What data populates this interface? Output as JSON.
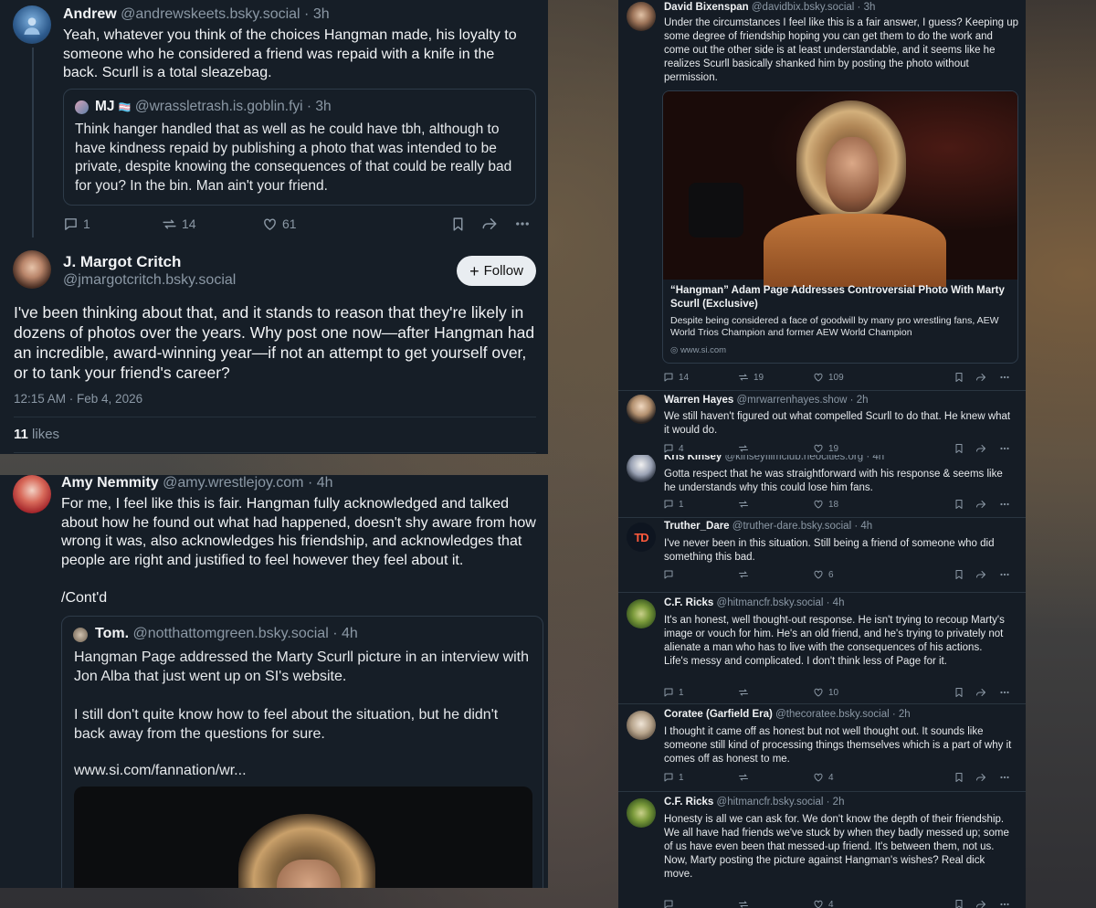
{
  "left_top": {
    "andrew": {
      "name": "Andrew",
      "handle": "@andrewskeets.bsky.social",
      "time": "3h",
      "text": "Yeah, whatever you think of the choices Hangman made, his loyalty to someone who he considered a friend was repaid with a knife in the back. Scurll is a total sleazebag.",
      "quote": {
        "name": "MJ",
        "flag": "🏳️‍⚧️",
        "handle": "@wrassletrash.is.goblin.fyi",
        "time": "3h",
        "text": "Think hanger handled that as well as he could have tbh, although to have kindness repaid by publishing a photo that was intended to be private, despite knowing the consequences of that could be really bad for you? In the bin. Man ain't your friend."
      },
      "replies": "1",
      "reposts": "14",
      "likes": "61"
    },
    "margot": {
      "name": "J. Margot Critch",
      "handle": "@jmargotcritch.bsky.social",
      "follow_label": "Follow",
      "text": "I've been thinking about that, and it stands to reason that they're likely in dozens of photos over the years. Why post one now—after Hangman had an incredible, award-winning year—if not an attempt to get yourself over, or to tank your friend's career?",
      "timestamp": "12:15 AM · Feb 4, 2026",
      "likes_count": "11",
      "likes_label": "likes"
    }
  },
  "left_bottom": {
    "amy": {
      "name": "Amy Nemmity",
      "handle": "@amy.wrestlejoy.com",
      "time": "4h",
      "text": "For me, I feel like this is fair. Hangman fully acknowledged and talked about how he found out what had happened, doesn't shy aware from how wrong it was, also acknowledges his friendship, and acknowledges that people are right and justified to feel however they feel about it.",
      "cont": "/Cont'd",
      "quote": {
        "name": "Tom.",
        "handle": "@notthattomgreen.bsky.social",
        "time": "4h",
        "text1": "Hangman Page addressed the Marty Scurll picture in an interview with Jon Alba that just went up on SI's website.",
        "text2": "I still don't quite know how to feel about the situation, but he didn't back away from the questions for sure.",
        "link": "www.si.com/fannation/wr..."
      }
    }
  },
  "right_top": {
    "david": {
      "name": "David Bixenspan",
      "handle": "@davidbix.bsky.social",
      "time": "3h",
      "text": "Under the circumstances I feel like this is a fair answer, I guess? Keeping up some degree of friendship hoping you can get them to do the work and come out the other side is at least understandable, and it seems like he realizes Scurll basically shanked him by posting the photo without permission.",
      "card": {
        "title": "“Hangman” Adam Page Addresses Controversial Photo With Marty Scurll (Exclusive)",
        "desc": "Despite being considered a face of goodwill by many pro wrestling fans, AEW World Trios Champion and former AEW World Champion",
        "domain": "www.si.com"
      },
      "replies": "14",
      "reposts": "19",
      "likes": "109"
    },
    "warren": {
      "name": "Warren Hayes",
      "handle": "@mrwarrenhayes.show",
      "time": "2h",
      "text": "We still haven't figured out what compelled Scurll to do that. He knew what it would do.",
      "replies": "4",
      "likes": "19"
    }
  },
  "right_bottom": {
    "posts": [
      {
        "name": "Kris Kinsey",
        "handle": "@kinseyfilmclub.neocities.org",
        "time": "4h",
        "text": "Gotta respect that he was straightforward with his response & seems like he understands why this could lose him fans.",
        "replies": "1",
        "likes": "18"
      },
      {
        "name": "Truther_Dare",
        "handle": "@truther-dare.bsky.social",
        "time": "4h",
        "text": "I've never been in this situation.  Still being a friend of someone who did something this bad.",
        "replies": "",
        "likes": "6",
        "avatar_text": "TD"
      },
      {
        "name": "C.F. Ricks",
        "handle": "@hitmancfr.bsky.social",
        "time": "4h",
        "text": "It's an honest, well thought-out response. He isn't trying to recoup Marty's image or vouch for him. He's an old friend, and he's trying to privately not alienate a man who has to live with the consequences of his actions.\nLife's messy and complicated. I don't think less of Page for it.",
        "replies": "1",
        "likes": "10"
      },
      {
        "name": "Coratee (Garfield Era)",
        "handle": "@thecoratee.bsky.social",
        "time": "2h",
        "text": "I thought it came off as honest but not well thought out. It sounds like someone still kind of processing things themselves which is a part of why it comes off as honest to me.",
        "replies": "1",
        "likes": "4"
      },
      {
        "name": "C.F. Ricks",
        "handle": "@hitmancfr.bsky.social",
        "time": "2h",
        "text": "Honesty is all we can ask for. We don't know the depth of their friendship. We all have had friends we've stuck by when they badly messed up; some of us have even been that messed-up friend. It's between them, not us.\nNow, Marty posting the picture against Hangman's wishes? Real dick move.",
        "replies": "",
        "likes": "4"
      }
    ]
  },
  "colors": {
    "panel": "#161e27",
    "text": "#f1f3f5",
    "muted": "#8b98a5",
    "border": "#2e3b49"
  }
}
